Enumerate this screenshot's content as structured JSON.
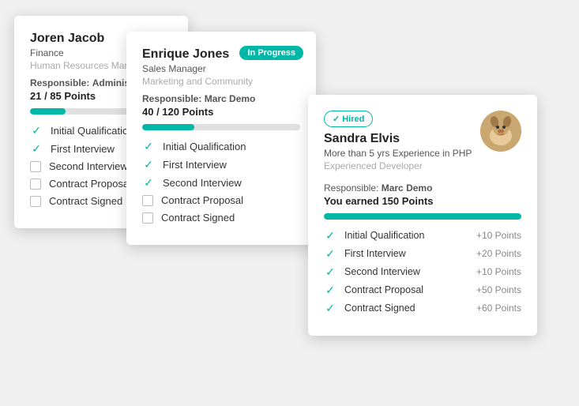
{
  "card1": {
    "name": "Joren Jacob",
    "role": "Finance",
    "dept": "Human Resources Manager",
    "responsible_label": "Responsible:",
    "responsible_value": "Administrator",
    "points": "21 / 85 Points",
    "progress": 25,
    "items": [
      {
        "label": "Initial Qualification",
        "checked": true
      },
      {
        "label": "First Interview",
        "checked": true
      },
      {
        "label": "Second Interview",
        "checked": false
      },
      {
        "label": "Contract Proposal",
        "checked": false
      },
      {
        "label": "Contract Signed",
        "checked": false
      }
    ]
  },
  "card2": {
    "name": "Enrique Jones",
    "role": "Sales Manager",
    "dept": "Marketing and Community",
    "badge": "In Progress",
    "responsible_label": "Responsible:",
    "responsible_value": "Marc Demo",
    "points": "40 / 120 Points",
    "progress": 33,
    "items": [
      {
        "label": "Initial Qualification",
        "checked": true
      },
      {
        "label": "First Interview",
        "checked": true
      },
      {
        "label": "Second Interview",
        "checked": true
      },
      {
        "label": "Contract Proposal",
        "checked": false
      },
      {
        "label": "Contract Signed",
        "checked": false
      }
    ]
  },
  "card3": {
    "name": "Sandra Elvis",
    "role": "More than 5 yrs Experience in PHP",
    "dept": "Experienced Developer",
    "badge": "✓ Hired",
    "responsible_label": "Responsible:",
    "responsible_value": "Marc Demo",
    "earned": "You earned 150 Points",
    "progress": 100,
    "items": [
      {
        "label": "Initial Qualification",
        "checked": true,
        "points": "+10 Points"
      },
      {
        "label": "First Interview",
        "checked": true,
        "points": "+20 Points"
      },
      {
        "label": "Second Interview",
        "checked": true,
        "points": "+10 Points"
      },
      {
        "label": "Contract Proposal",
        "checked": true,
        "points": "+50 Points"
      },
      {
        "label": "Contract Signed",
        "checked": true,
        "points": "+60 Points"
      }
    ]
  }
}
